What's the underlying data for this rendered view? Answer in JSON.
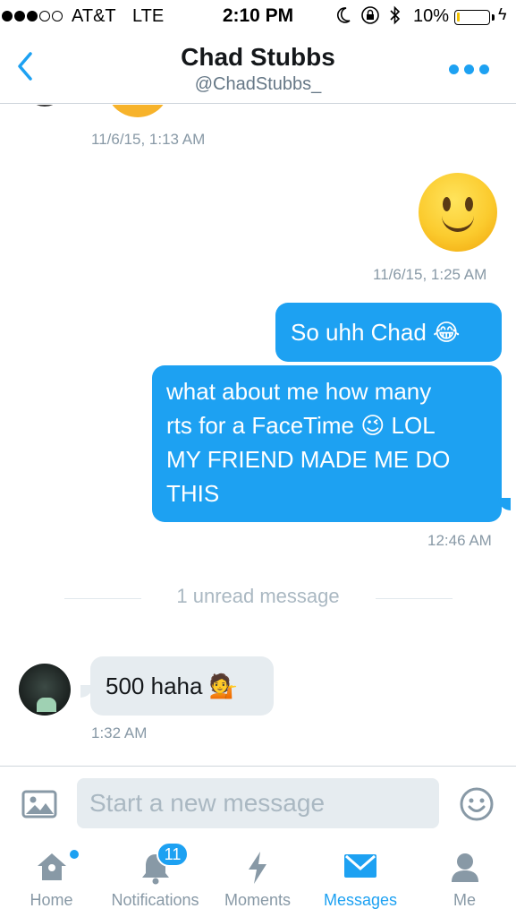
{
  "status_bar": {
    "carrier": "AT&T",
    "network": "LTE",
    "time": "2:10 PM",
    "battery_percent": "10%",
    "battery_level": 0.1,
    "battery_color": "#f2c200",
    "icons": [
      "moon-icon",
      "orientation-lock-icon",
      "bluetooth-icon",
      "charging-bolt-icon"
    ]
  },
  "header": {
    "name": "Chad Stubbs",
    "handle": "@ChadStubbs_",
    "back_icon": "chevron-left-icon",
    "more_icon": "more-dots-icon"
  },
  "conversation": {
    "timestamp_1": "11/6/15, 1:13 AM",
    "sent_emoji": "slightly-smiling-face",
    "timestamp_2": "11/6/15, 1:25 AM",
    "sent_message_1": "So uhh Chad 😂",
    "sent_message_2_lines": [
      "what about me how many",
      "rts for a FaceTime 😉 LOL",
      "MY FRIEND MADE ME DO",
      "THIS"
    ],
    "timestamp_3": "12:46 AM",
    "unread_divider": "1 unread message",
    "received_message": "500 haha 💁",
    "timestamp_4": "1:32 AM"
  },
  "composer": {
    "placeholder": "Start a new message",
    "photo_icon": "photo-icon",
    "emoji_icon": "smiley-icon"
  },
  "tabbar": {
    "tabs": [
      {
        "label": "Home",
        "icon": "home-icon"
      },
      {
        "label": "Notifications",
        "icon": "bell-icon",
        "badge": "11"
      },
      {
        "label": "Moments",
        "icon": "lightning-icon"
      },
      {
        "label": "Messages",
        "icon": "envelope-icon",
        "active": true
      },
      {
        "label": "Me",
        "icon": "person-icon"
      }
    ]
  },
  "colors": {
    "accent": "#1da1f2",
    "received_bubble": "#e6ecf0",
    "muted_text": "#8899a6"
  }
}
